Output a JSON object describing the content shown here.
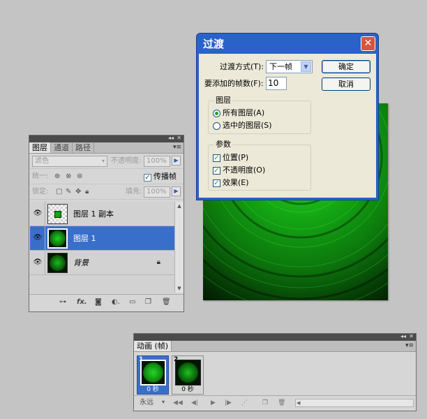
{
  "colors": {
    "accent": "#3a6ecb",
    "dialog_title_bg": "#2a62c9",
    "green": "#1bd21b"
  },
  "layers_panel": {
    "tabs": [
      "图层",
      "通道",
      "路径"
    ],
    "blend_mode": "滤色",
    "opacity_label": "不透明度:",
    "opacity_value": "100%",
    "unify_label": "统一:",
    "propagate_label": "传播帧 1",
    "propagate_checked": true,
    "lock_label": "锁定:",
    "fill_label": "填充:",
    "fill_value": "100%",
    "layers": [
      {
        "name": "图层 1 副本",
        "selected": false,
        "visible": true,
        "locked": false
      },
      {
        "name": "图层 1",
        "selected": true,
        "visible": true,
        "locked": false
      },
      {
        "name": "背景",
        "selected": false,
        "visible": true,
        "locked": true
      }
    ],
    "footer_icons": [
      "link-icon",
      "fx-icon",
      "mask-icon",
      "adjustment-icon",
      "group-icon",
      "new-layer-icon",
      "trash-icon"
    ]
  },
  "dialog": {
    "title": "过渡",
    "transition_label": "过渡方式(T):",
    "transition_value": "下一帧",
    "frames_label": "要添加的帧数(F):",
    "frames_value": "10",
    "ok_label": "确定",
    "cancel_label": "取消",
    "layers_group": {
      "title": "图层",
      "options": [
        {
          "label": "所有图层(A)",
          "selected": true
        },
        {
          "label": "选中的图层(S)",
          "selected": false
        }
      ]
    },
    "params_group": {
      "title": "参数",
      "options": [
        {
          "label": "位置(P)",
          "checked": true
        },
        {
          "label": "不透明度(O)",
          "checked": true
        },
        {
          "label": "效果(E)",
          "checked": true
        }
      ]
    }
  },
  "animation_panel": {
    "tab": "动画 (帧)",
    "frames": [
      {
        "number": "1",
        "time": "0 秒",
        "selected": true
      },
      {
        "number": "2",
        "time": "0 秒",
        "selected": false
      }
    ],
    "loop": "永远"
  }
}
